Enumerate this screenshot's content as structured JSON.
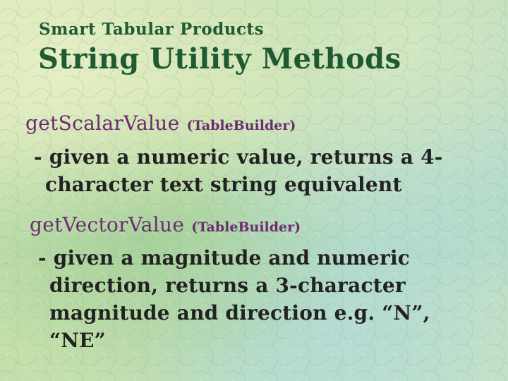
{
  "slide": {
    "subtitle": "Smart Tabular Products",
    "title": "String Utility Methods",
    "methods": [
      {
        "name": "getScalarValue",
        "class": "(TableBuilder)",
        "description_lines": [
          "- given a numeric value, returns a 4-",
          "character text string equivalent"
        ]
      },
      {
        "name": "getVectorValue",
        "class": "(TableBuilder)",
        "description_lines": [
          "- given a magnitude and numeric",
          "direction, returns a 3-character",
          "magnitude and direction e.g. “N”,",
          "“NE”"
        ]
      }
    ]
  },
  "colors": {
    "heading": "#1f5a32",
    "method": "#6b2c70",
    "body_text": "#222222",
    "background": "#c4dfb0"
  }
}
